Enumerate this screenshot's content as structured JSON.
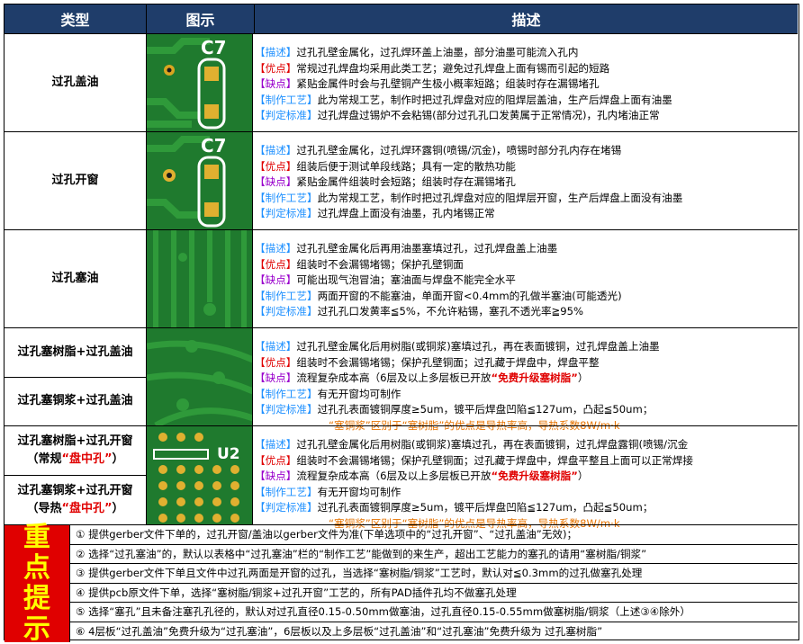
{
  "header": {
    "type": "类型",
    "image": "图示",
    "desc": "描述"
  },
  "rows": [
    {
      "type": "过孔盖油",
      "lines": [
        {
          "tag": "【描述】",
          "text": "过孔孔壁金属化，过孔焊环盖上油墨，部分油墨可能流入孔内"
        },
        {
          "tag": "【优点】",
          "text": "常规过孔焊盘均采用此类工艺；避免过孔焊盘上面有锡而引起的短路"
        },
        {
          "tag": "【缺点】",
          "text": "紧贴金属件时会与孔壁铜产生极小概率短路；组装时存在漏锡堵孔"
        },
        {
          "tag": "【制作工艺】",
          "text": "此为常规工艺，制作时把过孔焊盘对应的阻焊层盖油，生产后焊盘上面有油墨"
        },
        {
          "tag": "【判定标准】",
          "text": "过孔焊盘过锡炉不会粘锡(部分过孔孔口发黄属于正常情况)，孔内堵油正常"
        }
      ],
      "silk": "C7"
    },
    {
      "type": "过孔开窗",
      "lines": [
        {
          "tag": "【描述】",
          "text": "过孔孔壁金属化，过孔焊环露铜(喷锡/沉金)，喷锡时部分孔内存在堵锡"
        },
        {
          "tag": "【优点】",
          "text": "组装后便于测试单段线路；具有一定的散热功能"
        },
        {
          "tag": "【缺点】",
          "text": "紧贴金属件组装时会短路；组装时存在漏锡堵孔"
        },
        {
          "tag": "【制作工艺】",
          "text": "此为常规工艺，制作时把过孔焊盘对应的阻焊层开窗，生产后焊盘上面没有油墨"
        },
        {
          "tag": "【判定标准】",
          "text": "过孔焊盘上面没有油墨，孔内堵锡正常"
        }
      ],
      "silk": "C7"
    },
    {
      "type": "过孔塞油",
      "lines": [
        {
          "tag": "【描述】",
          "text": "过孔孔壁金属化后再用油墨塞填过孔，过孔焊盘盖上油墨"
        },
        {
          "tag": "【优点】",
          "text": "组装时不会漏锡堵锡；保护孔壁铜面"
        },
        {
          "tag": "【缺点】",
          "text": "可能出现气泡冒油；塞油面与焊盘不能完全水平"
        },
        {
          "tag": "【制作工艺】",
          "text": "两面开窗的不能塞油，单面开窗<0.4mm的孔做半塞油(可能透光)"
        },
        {
          "tag": "【判定标准】",
          "text": "过孔孔口发黄率≦5%，不允许粘锡，塞孔不透光率≧95%"
        }
      ]
    },
    {
      "types": [
        "过孔塞树脂+过孔盖油",
        "过孔塞铜浆+过孔盖油"
      ],
      "lines": [
        {
          "tag": "【描述】",
          "text": "过孔孔壁金属化后用树脂(或铜浆)塞填过孔，再在表面镀铜，过孔焊盘盖上油墨"
        },
        {
          "tag": "【优点】",
          "text": "组装时不会漏锡堵锡；保护孔壁铜面；过孔藏于焊盘中，焊盘平整"
        },
        {
          "tag": "【缺点】",
          "text": "流程复杂成本高（6层及以上多层板已开放",
          "hl": "“免费升级塞树脂”",
          "tail": "）"
        },
        {
          "tag": "【制作工艺】",
          "text": "有无开窗均可制作"
        },
        {
          "tag": "【判定标准】",
          "text": "过孔孔表面镀铜厚度≥5um，镀平后焊盘凹陷≦127um，凸起≦50um；"
        }
      ],
      "cont": [
        "“塞铜浆”区别于“塞树脂”的优点是导热率高，导热系数8W/m·k"
      ]
    },
    {
      "types": [
        {
          "main": "过孔塞树脂+过孔开窗",
          "sub_pre": "（常规",
          "sub_red": "“盘中孔”",
          "sub_post": "）"
        },
        {
          "main": "过孔塞铜浆+过孔开窗",
          "sub_pre": "（导热",
          "sub_red": "“盘中孔”",
          "sub_post": "）"
        }
      ],
      "lines": [
        {
          "tag": "【描述】",
          "text": "过孔孔壁金属化后用树脂(或铜浆)塞填过孔，再在表面镀铜，过孔焊盘露铜(喷锡/沉金"
        },
        {
          "tag": "【优点】",
          "text": "组装时不会漏锡堵锡；保护孔壁铜面；过孔藏于焊盘中，焊盘平整且上面可以正常焊接"
        },
        {
          "tag": "【缺点】",
          "text": "流程复杂成本高（6层及以上多层板已开放",
          "hl": "“免费升级塞树脂”",
          "tail": "）"
        },
        {
          "tag": "【制作工艺】",
          "text": "有无开窗均可制作"
        },
        {
          "tag": "【判定标准】",
          "text": "过孔孔表面镀铜厚度≥5um，镀平后焊盘凹陷≦127um，凸起≦50um；"
        }
      ],
      "cont": [
        "“塞铜浆”区别于“塞树脂”的优点是导热率高，导热系数8W/m·k"
      ],
      "silk": "U2"
    }
  ],
  "keynote": {
    "chars": [
      "重",
      "点",
      "提",
      "示"
    ]
  },
  "notes": [
    "① 提供gerber文件下单的，过孔开窗/盖油以gerber文件为准(下单选项中的“过孔开窗”、“过孔盖油”无效)；",
    "② 选择“过孔塞油”的，默认以表格中“过孔塞油”栏的“制作工艺”能做到的来生产，超出工艺能力的塞孔的请用“塞树脂/铜浆”",
    "③ 提供gerber文件下单且文件中过孔两面是开窗的过孔，当选择“塞树脂/铜浆”工艺时，默认对≦0.3mm的过孔做塞孔处理",
    "④ 提供pcb原文件下单，选择“塞树脂/铜浆+过孔开窗”工艺的，所有PAD插件孔均不做塞孔处理",
    "⑤ 选择“塞孔”且未备注塞孔孔径的，默认对过孔直径0.15-0.50mm做塞油，过孔直径0.15-0.55mm做塞树脂/铜浆（上述③④除外）",
    "⑥ 4层板“过孔盖油”免费升级为“过孔塞油”，6层板以及上多层板“过孔盖油”和“过孔塞油”免费升级为 过孔塞树脂”"
  ],
  "colors": {
    "header_bg": "#1f3d6a",
    "header_text": "#ffffff",
    "pcb_green": "#1f7a2e",
    "trace_green": "#2f9a3a",
    "tag_blue": "#1e90ff",
    "tag_red": "#e00000",
    "tag_purple": "#9900cc",
    "orange": "#e67300",
    "key_red": "#e00000",
    "key_yellow": "#ffff00"
  }
}
